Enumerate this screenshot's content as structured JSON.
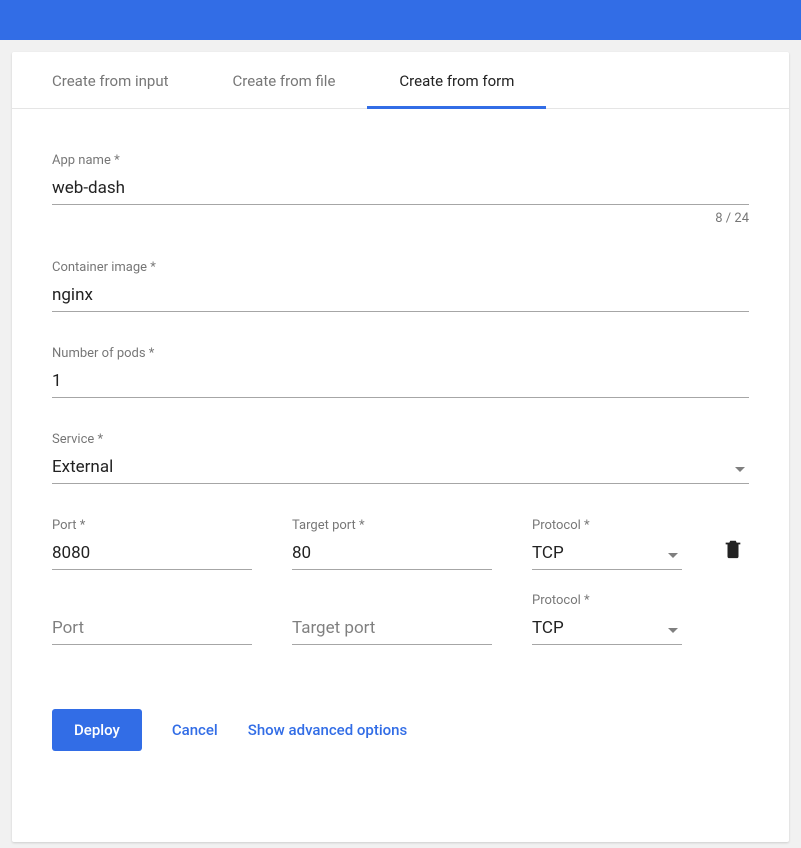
{
  "tabs": {
    "input": "Create from input",
    "file": "Create from file",
    "form": "Create from form"
  },
  "fields": {
    "appName": {
      "label": "App name *",
      "value": "web-dash",
      "counter": "8 / 24"
    },
    "containerImage": {
      "label": "Container image *",
      "value": "nginx"
    },
    "pods": {
      "label": "Number of pods *",
      "value": "1"
    },
    "service": {
      "label": "Service *",
      "value": "External"
    }
  },
  "ports": {
    "row1": {
      "port": {
        "label": "Port *",
        "value": "8080"
      },
      "targetPort": {
        "label": "Target port *",
        "value": "80"
      },
      "protocol": {
        "label": "Protocol *",
        "value": "TCP"
      }
    },
    "row2": {
      "port": {
        "placeholder": "Port"
      },
      "targetPort": {
        "placeholder": "Target port"
      },
      "protocol": {
        "label": "Protocol *",
        "value": "TCP"
      }
    }
  },
  "actions": {
    "deploy": "Deploy",
    "cancel": "Cancel",
    "advanced": "Show advanced options"
  }
}
